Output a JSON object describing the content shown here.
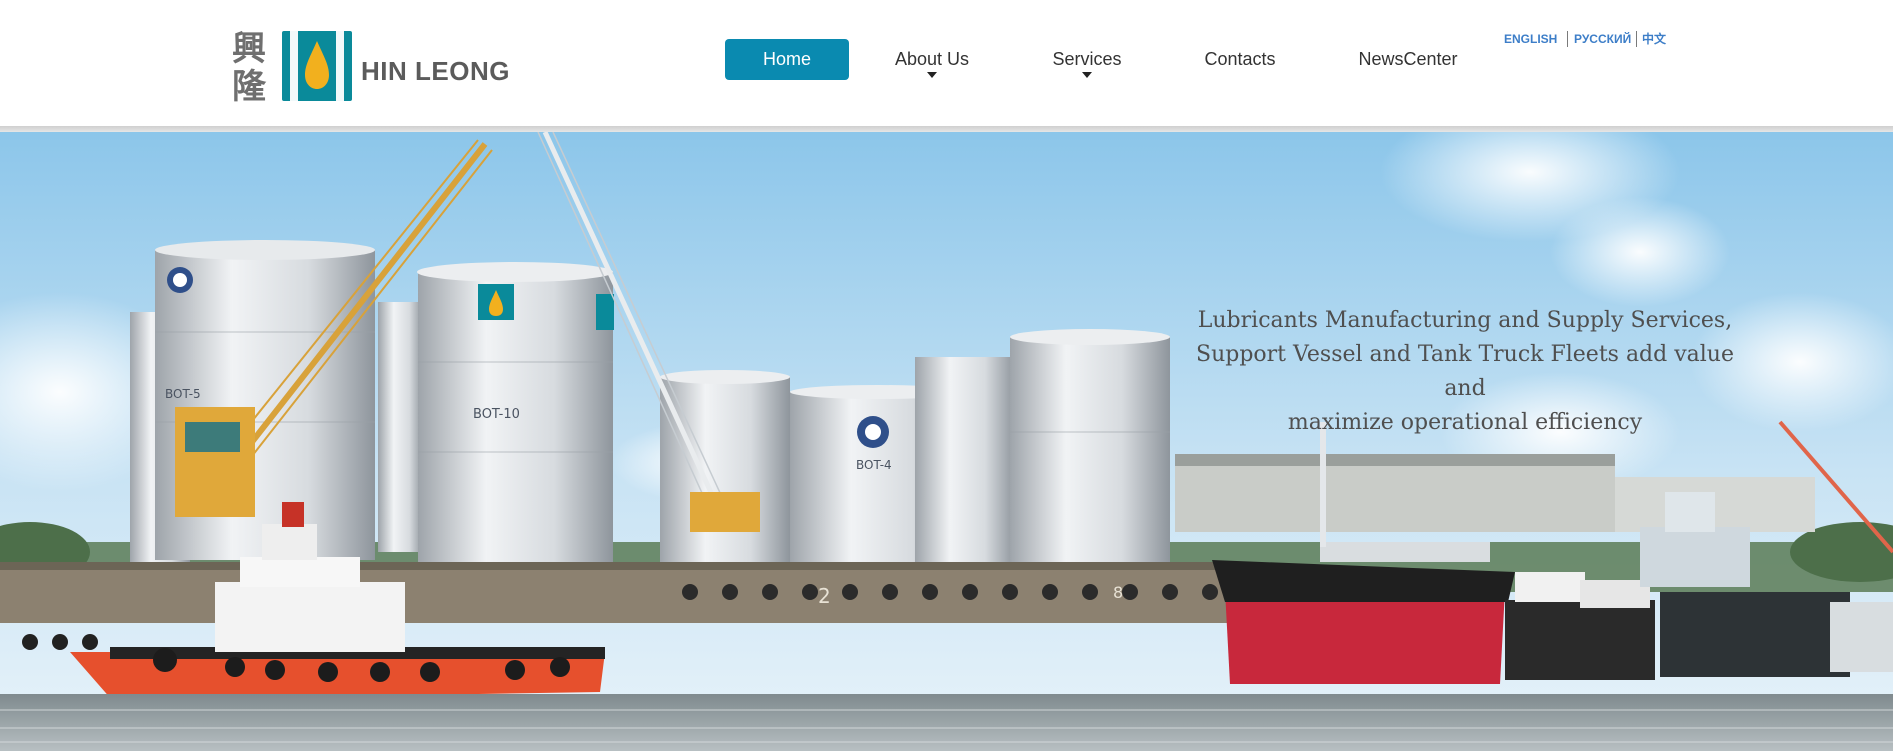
{
  "logo": {
    "chinese_name": "興隆",
    "english_name": "HIN LEONG",
    "mark_colors": {
      "teal": "#0a8a9a",
      "gold": "#f2b01e"
    }
  },
  "nav": {
    "items": [
      {
        "label": "Home",
        "active": true,
        "has_dropdown": false
      },
      {
        "label": "About Us",
        "active": false,
        "has_dropdown": true
      },
      {
        "label": "Services",
        "active": false,
        "has_dropdown": true
      },
      {
        "label": "Contacts",
        "active": false,
        "has_dropdown": false
      },
      {
        "label": "NewsCenter",
        "active": false,
        "has_dropdown": false
      }
    ],
    "active_color": "#0a8ab0"
  },
  "languages": [
    "ENGLISH",
    "РУССКИЙ",
    "中文"
  ],
  "hero": {
    "tagline_lines": [
      "Lubricants Manufacturing and Supply Services,",
      "Support Vessel and Tank Truck Fleets add value and",
      "maximize operational efficiency"
    ],
    "tank_labels": [
      "BOT-5",
      "BOT-10",
      "BOT-4"
    ],
    "quay_numbers": [
      "2",
      "8"
    ]
  }
}
